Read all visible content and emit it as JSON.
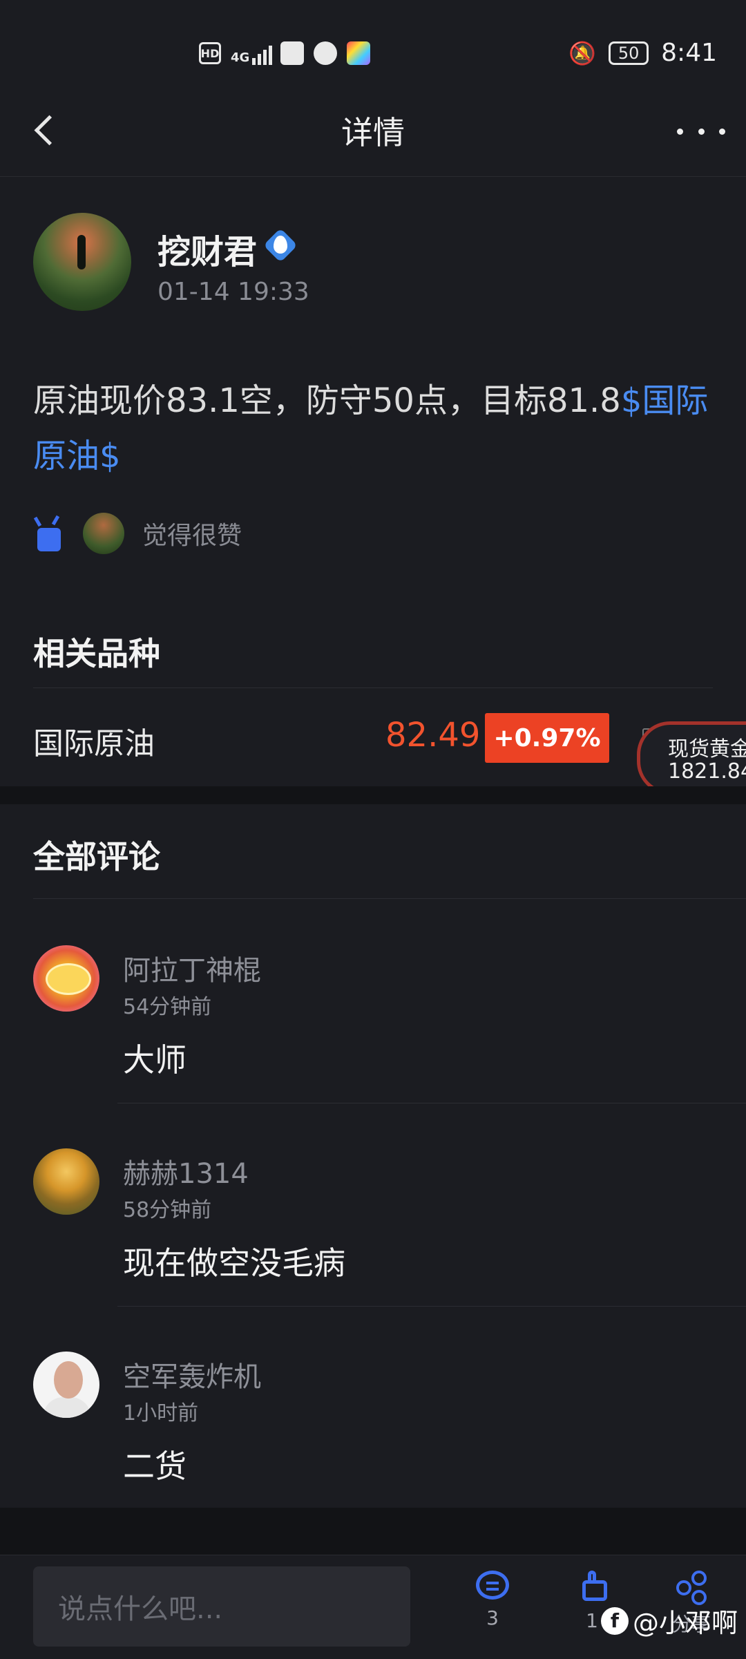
{
  "status_bar": {
    "time": "8:41",
    "battery": "50",
    "hd": "HD",
    "net": "4G"
  },
  "nav": {
    "title": "详情"
  },
  "post": {
    "author": "挖财君",
    "time": "01-14 19:33",
    "text_plain": "原油现价83.1空，防守50点，目标81.8",
    "text_tag": "$国际原油$",
    "likes_text": "觉得很赞"
  },
  "related": {
    "title": "相关品种",
    "item": {
      "name": "国际原油",
      "price": "82.49",
      "change": "+0.97%"
    },
    "float": {
      "name": "现货黄金",
      "price": "1821.84"
    }
  },
  "comments": {
    "title": "全部评论",
    "items": [
      {
        "name": "阿拉丁神棍",
        "time": "54分钟前",
        "text": "大师"
      },
      {
        "name": "赫赫1314",
        "time": "58分钟前",
        "text": "现在做空没毛病"
      },
      {
        "name": "空军轰炸机",
        "time": "1小时前",
        "text": "二货"
      }
    ]
  },
  "bottom_bar": {
    "placeholder": "说点什么吧...",
    "comment_count": "3",
    "like_count": "1",
    "share_label": "分享",
    "watermark": "@小邓啊"
  },
  "colors": {
    "background": "#1b1c21",
    "accent_blue": "#3d6ef0",
    "up_red": "#ec4224"
  }
}
